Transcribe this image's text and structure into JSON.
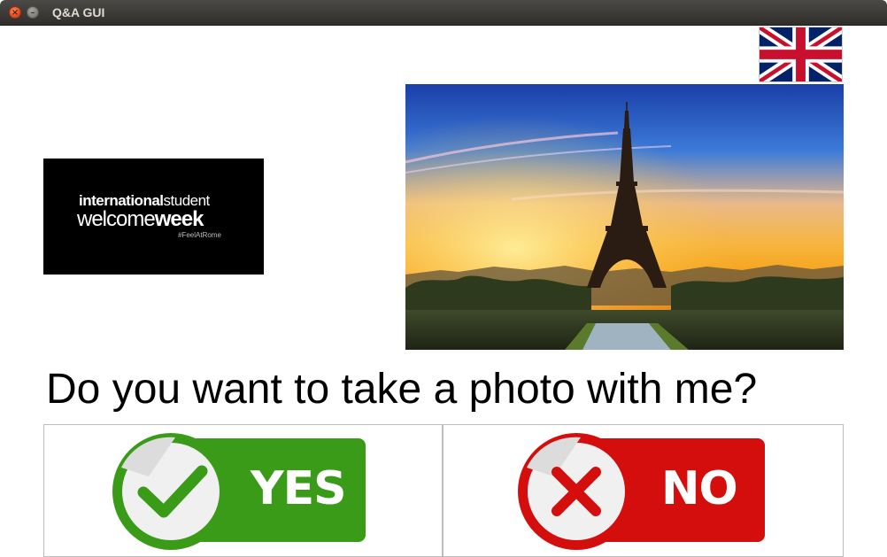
{
  "window": {
    "title": "Q&A GUI",
    "close_glyph": "×",
    "minimize_glyph": "–"
  },
  "flag": {
    "icon": "uk-flag-icon"
  },
  "logo": {
    "line1_regular": "international",
    "line1_bold": "",
    "line1_suffix": "student",
    "line2_regular": "welcome",
    "line2_bold": "week",
    "hashtag": "#FeelAtRome"
  },
  "photo": {
    "subject": "eiffel-tower-photo"
  },
  "question": {
    "text": "Do you want to take a photo with me?"
  },
  "buttons": {
    "yes": {
      "label": "YES",
      "color": "#3a9b18"
    },
    "no": {
      "label": "NO",
      "color": "#d40d0d"
    }
  }
}
